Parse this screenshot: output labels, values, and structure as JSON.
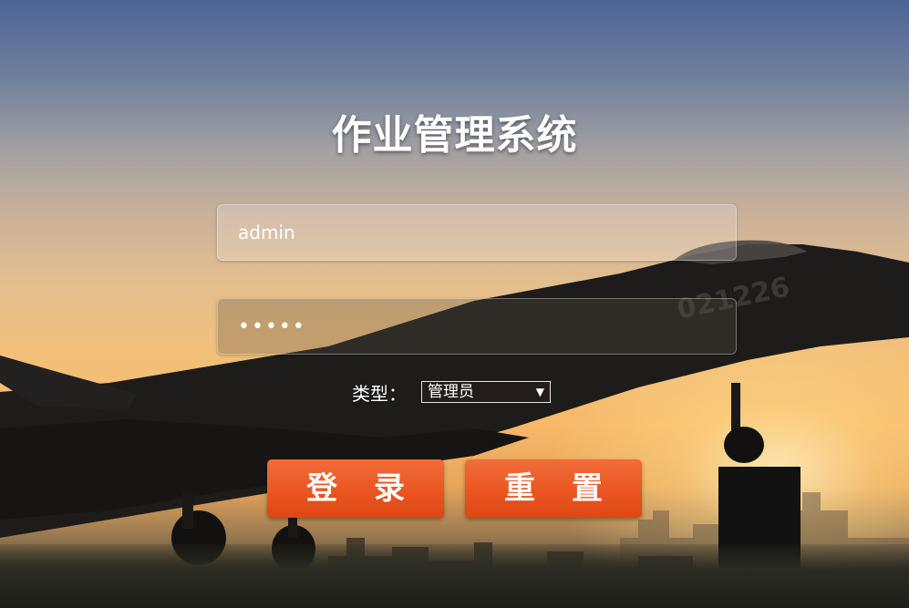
{
  "title": "作业管理系统",
  "username": {
    "value": "admin"
  },
  "password": {
    "masked_value": "•••••"
  },
  "type_selector": {
    "label": "类型：",
    "selected": "管理员"
  },
  "buttons": {
    "login": "登录",
    "reset": "重置"
  },
  "background": {
    "jet_tail_number": "021226"
  },
  "colors": {
    "button_orange": "#e9531f",
    "text": "#ffffff"
  }
}
